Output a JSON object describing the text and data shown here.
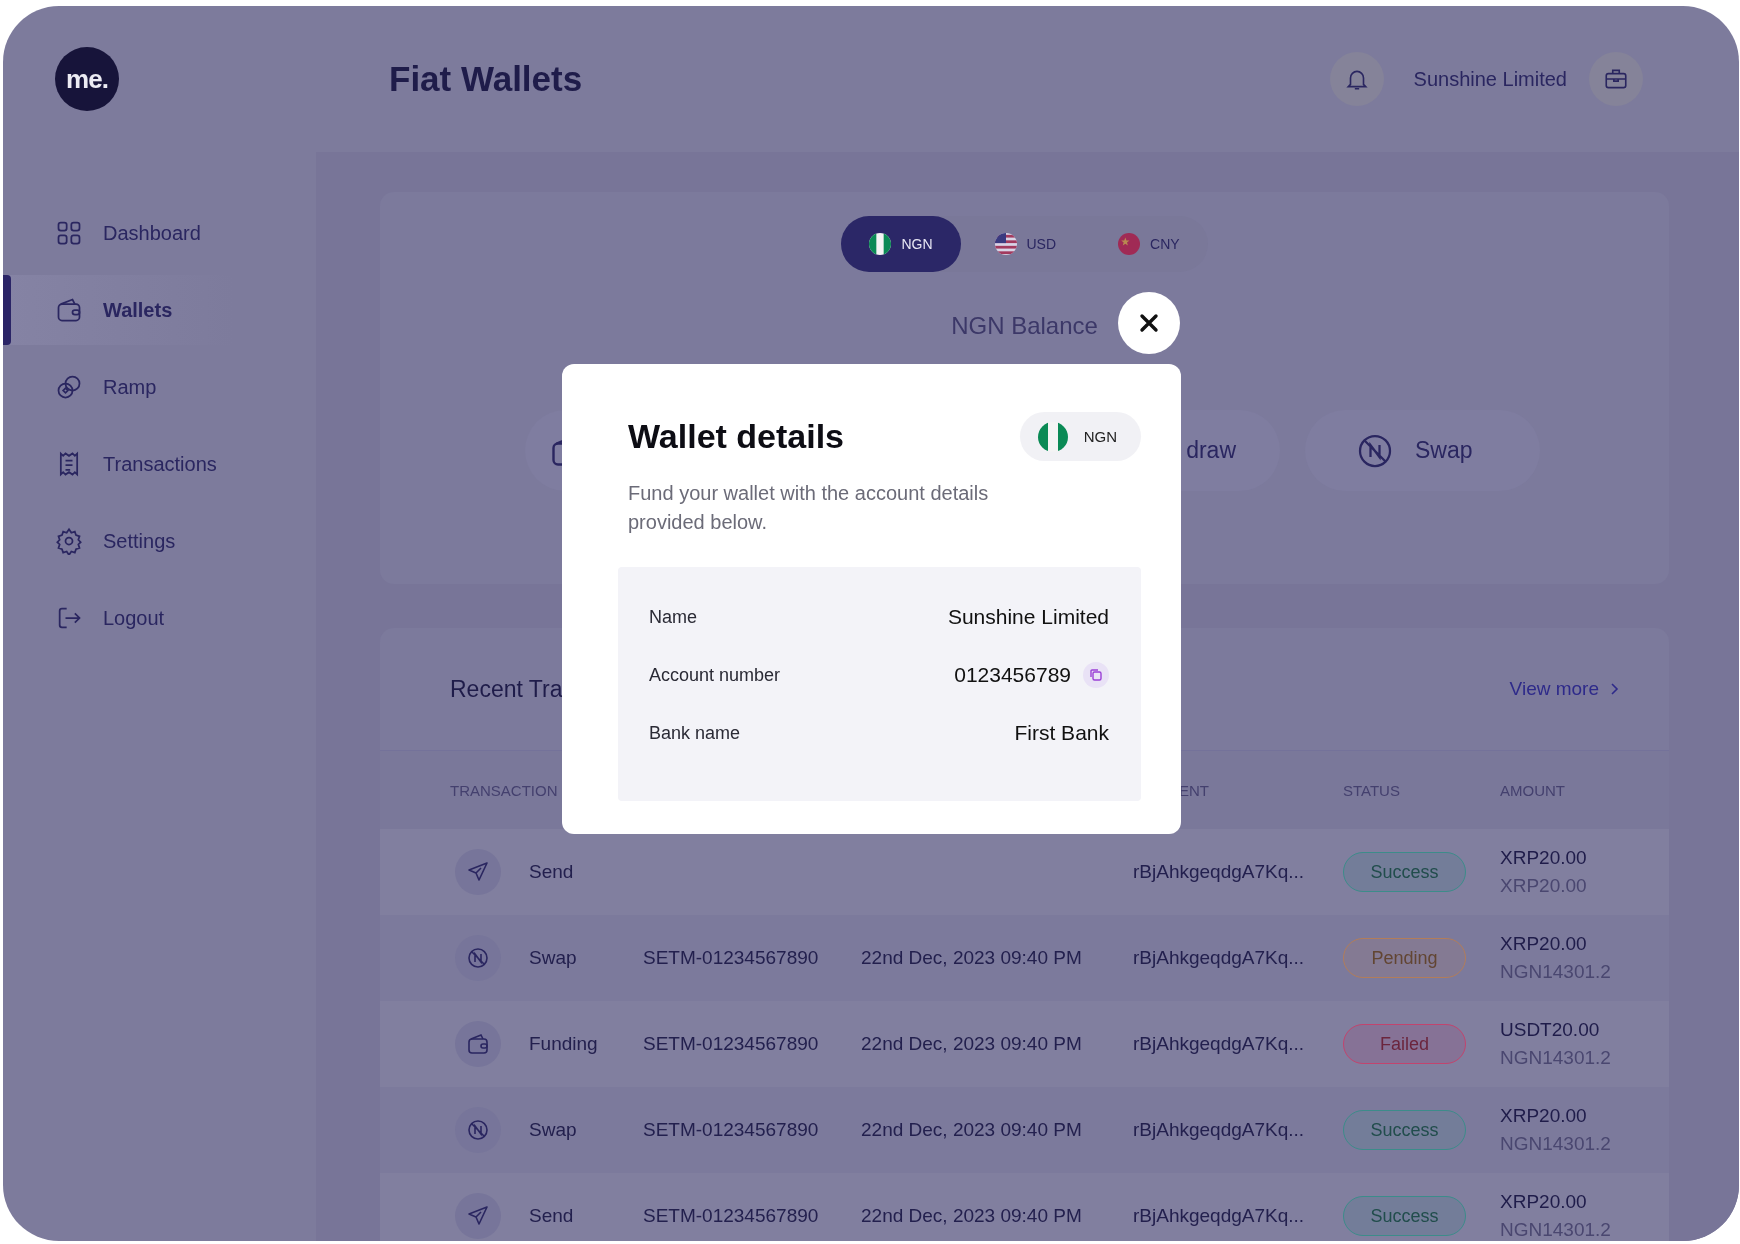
{
  "logo": {
    "text": "me."
  },
  "header": {
    "title": "Fiat Wallets",
    "account_name": "Sunshine Limited"
  },
  "sidebar": {
    "items": [
      {
        "label": "Dashboard",
        "selected": false
      },
      {
        "label": "Wallets",
        "selected": true
      },
      {
        "label": "Ramp",
        "selected": false
      },
      {
        "label": "Transactions",
        "selected": false
      },
      {
        "label": "Settings",
        "selected": false
      },
      {
        "label": "Logout",
        "selected": false
      }
    ]
  },
  "wallet_card": {
    "currency_tabs": [
      {
        "code": "NGN",
        "selected": true
      },
      {
        "code": "USD",
        "selected": false
      },
      {
        "code": "CNY",
        "selected": false
      }
    ],
    "balance_label": "NGN Balance",
    "actions": [
      {
        "kind": "wallet"
      },
      {
        "kind": "withdraw",
        "label": "draw"
      },
      {
        "kind": "swap",
        "label": "Swap"
      }
    ]
  },
  "recent_transactions": {
    "title": "Recent Tra",
    "view_more": "View more",
    "columns": {
      "column_1": "TRANSACTION",
      "column_4": "ENT",
      "column_5": "STATUS",
      "column_6": "AMOUNT"
    },
    "rows": [
      {
        "kind": "send",
        "type": "Send",
        "recipient": "rBjAhkgeqdgA7Kq...",
        "status": "Success",
        "color": "#3c8c8a",
        "amount": "XRP20.00",
        "amount_2": "XRP20.00"
      },
      {
        "kind": "swap",
        "type": "Swap",
        "id": "SETM-01234567890",
        "date": "22nd Dec, 2023 09:40 PM",
        "recipient": "rBjAhkgeqdgA7Kq...",
        "status": "Pending",
        "color": "#b27d5a",
        "amount": "XRP20.00",
        "amount_2": "NGN14301.2"
      },
      {
        "kind": "funding",
        "type": "Funding",
        "id": "SETM-01234567890",
        "date": "22nd Dec, 2023 09:40 PM",
        "recipient": "rBjAhkgeqdgA7Kq...",
        "status": "Failed",
        "color": "#c2446e",
        "amount": "USDT20.00",
        "amount_2": "NGN14301.2"
      },
      {
        "kind": "swap",
        "type": "Swap",
        "id": "SETM-01234567890",
        "date": "22nd Dec, 2023 09:40 PM",
        "recipient": "rBjAhkgeqdgA7Kq...",
        "status": "Success",
        "color": "#3c8c8a",
        "amount": "XRP20.00",
        "amount_2": "NGN14301.2"
      },
      {
        "kind": "send",
        "type": "Send",
        "id": "SETM-01234567890",
        "date": "22nd Dec, 2023 09:40 PM",
        "recipient": "rBjAhkgeqdgA7Kq...",
        "status": "Success",
        "color": "#3c8c8a",
        "amount": "XRP20.00",
        "amount_2": "NGN14301.2"
      }
    ]
  },
  "modal": {
    "title": "Wallet details",
    "currency": "NGN",
    "description": "Fund your wallet with the account details provided below.",
    "details": [
      {
        "label": "Name",
        "value": "Sunshine Limited"
      },
      {
        "label": "Account number",
        "value": "0123456789",
        "copyable": true
      },
      {
        "label": "Bank name",
        "value": "First Bank"
      }
    ]
  }
}
